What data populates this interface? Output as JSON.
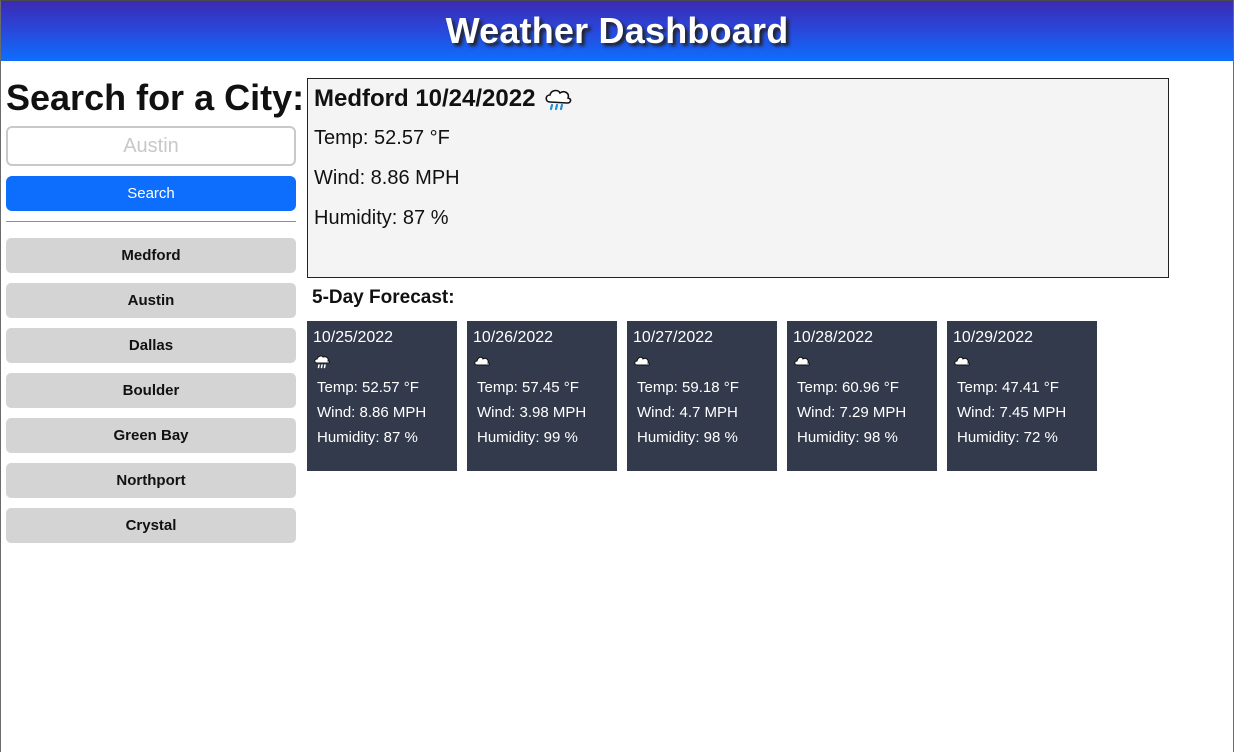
{
  "header": {
    "title": "Weather Dashboard"
  },
  "sidebar": {
    "heading": "Search for a City:",
    "search_placeholder": "Austin",
    "search_button": "Search",
    "history": [
      "Medford",
      "Austin",
      "Dallas",
      "Boulder",
      "Green Bay",
      "Northport",
      "Crystal"
    ]
  },
  "current": {
    "title": "Medford 10/24/2022",
    "icon": "rain-cloud-icon",
    "temp": "Temp: 52.57 °F",
    "wind": "Wind: 8.86 MPH",
    "humidity": "Humidity: 87 %"
  },
  "forecast": {
    "heading": "5-Day Forecast:",
    "days": [
      {
        "date": "10/25/2022",
        "icon": "rain-cloud-icon",
        "temp": "Temp: 52.57 °F",
        "wind": "Wind: 8.86 MPH",
        "humidity": "Humidity: 87 %"
      },
      {
        "date": "10/26/2022",
        "icon": "cloud-icon",
        "temp": "Temp: 57.45 °F",
        "wind": "Wind: 3.98 MPH",
        "humidity": "Humidity: 99 %"
      },
      {
        "date": "10/27/2022",
        "icon": "cloud-icon",
        "temp": "Temp: 59.18 °F",
        "wind": "Wind: 4.7 MPH",
        "humidity": "Humidity: 98 %"
      },
      {
        "date": "10/28/2022",
        "icon": "cloud-icon",
        "temp": "Temp: 60.96 °F",
        "wind": "Wind: 7.29 MPH",
        "humidity": "Humidity: 98 %"
      },
      {
        "date": "10/29/2022",
        "icon": "cloud-icon",
        "temp": "Temp: 47.41 °F",
        "wind": "Wind: 7.45 MPH",
        "humidity": "Humidity: 72 %"
      }
    ]
  },
  "colors": {
    "header_gradient_top": "#3b2ab3",
    "header_gradient_bottom": "#0d6efd",
    "search_button": "#0d6efd",
    "history_button": "#d4d4d4",
    "forecast_card": "#323a4b",
    "current_panel": "#f4f4f4"
  }
}
